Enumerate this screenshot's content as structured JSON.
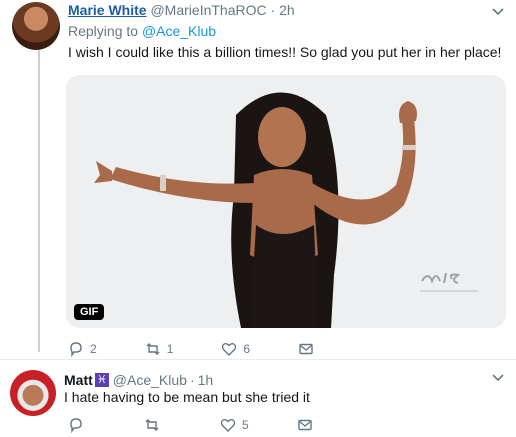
{
  "tweet1": {
    "name": "Marie White",
    "handle": "@MarieInThaROC",
    "sep": "·",
    "time": "2h",
    "replying_prefix": "Replying to",
    "replying_mention": "@Ace_Klub",
    "text": "I wish I could like this a billion times!! So glad you put her in her place!",
    "gif_label": "GIF",
    "reply_count": "2",
    "retweet_count": "1",
    "like_count": "6"
  },
  "tweet2": {
    "name": "Matt",
    "badge": "♓",
    "handle": "@Ace_Klub",
    "sep": "·",
    "time": "1h",
    "text": "I hate having to be mean but she tried it",
    "reply_count": "",
    "retweet_count": "",
    "like_count": "5"
  },
  "icons": {
    "reply": "reply-icon",
    "retweet": "retweet-icon",
    "like": "heart-icon",
    "dm": "envelope-icon",
    "more": "chevron-down-icon"
  },
  "colors": {
    "link": "#1b95e0",
    "name_link": "#1b5ea6",
    "muted": "#657786",
    "thread_line": "#c4cfd6"
  }
}
